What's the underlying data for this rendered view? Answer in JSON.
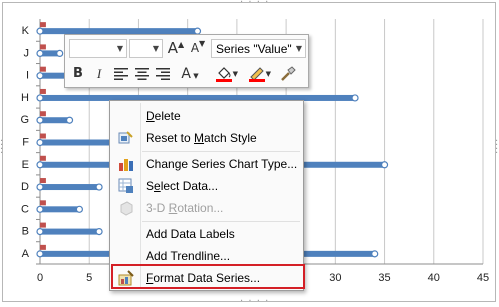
{
  "chart_data": {
    "type": "bar",
    "orientation": "horizontal",
    "categories": [
      "A",
      "B",
      "C",
      "D",
      "E",
      "F",
      "G",
      "H",
      "I",
      "J",
      "K"
    ],
    "series": [
      {
        "values": [
          34,
          6,
          4,
          6,
          35,
          25,
          3,
          32,
          4,
          2,
          16
        ],
        "color": "#4f81bd"
      },
      {
        "values": [
          0.6,
          0.6,
          0.6,
          0.6,
          0.6,
          0.6,
          0.6,
          0.6,
          0.6,
          0.6,
          0.6
        ],
        "color": "#c0504d"
      }
    ],
    "x_ticks": [
      "0",
      "5",
      "10",
      "15",
      "20",
      "25",
      "30",
      "35",
      "40",
      "45"
    ],
    "xlim": [
      0,
      45
    ],
    "grid": true
  },
  "toolbar": {
    "font_name_value": "",
    "font_size_value": "",
    "grow_font_icon": "A",
    "shrink_font_icon": "A",
    "series_select": "Series \"Value\"",
    "bold_label": "B",
    "italic_label": "I",
    "font_color_label": "A",
    "fill_color": "#ff0000",
    "outline_color": "#ff0000"
  },
  "menu": {
    "items": [
      {
        "label": "Delete",
        "icon": ""
      },
      {
        "label": "Reset to Match Style",
        "icon": "reset-style-icon"
      },
      {
        "label": "Change Series Chart Type...",
        "icon": "chart-type-icon"
      },
      {
        "label": "Select Data...",
        "icon": "select-data-icon"
      },
      {
        "label": "3-D Rotation...",
        "icon": "rotation-icon",
        "disabled": true
      },
      {
        "label": "Add Data Labels",
        "icon": ""
      },
      {
        "label": "Add Trendline...",
        "icon": ""
      },
      {
        "label": "Format Data Series...",
        "icon": "format-series-icon"
      }
    ]
  }
}
